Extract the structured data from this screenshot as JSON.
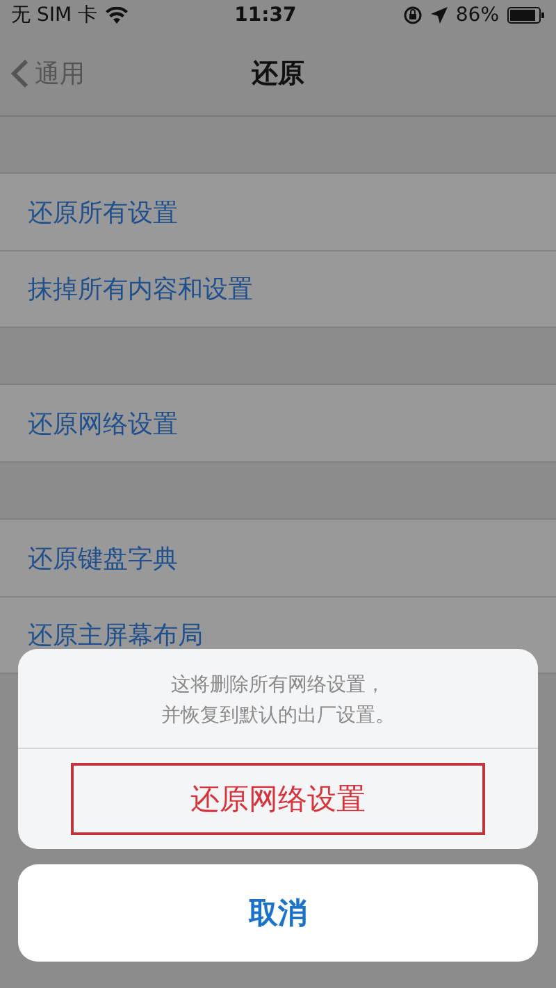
{
  "status_bar": {
    "carrier": "无 SIM 卡",
    "time": "11:37",
    "battery": "86%"
  },
  "nav": {
    "back": "通用",
    "title": "还原"
  },
  "sections": [
    {
      "items": [
        "还原所有设置",
        "抹掉所有内容和设置"
      ]
    },
    {
      "items": [
        "还原网络设置"
      ]
    },
    {
      "items": [
        "还原键盘字典",
        "还原主屏幕布局"
      ]
    }
  ],
  "action_sheet": {
    "message_lines": [
      "这将删除所有网络设置，",
      "并恢复到默认的出厂设置。"
    ],
    "actions": [
      {
        "label": "还原网络设置",
        "kind": "destructive",
        "highlighted": true
      }
    ],
    "cancel": "取消"
  }
}
